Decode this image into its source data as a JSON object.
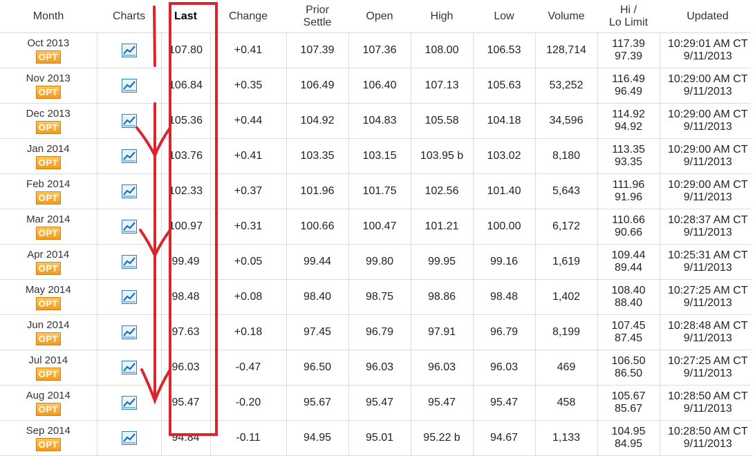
{
  "headers": {
    "month": "Month",
    "charts": "Charts",
    "last": "Last",
    "change": "Change",
    "prior_settle_line1": "Prior",
    "prior_settle_line2": "Settle",
    "open": "Open",
    "high": "High",
    "low": "Low",
    "volume": "Volume",
    "hilo_line1": "Hi /",
    "hilo_line2": "Lo Limit",
    "updated": "Updated"
  },
  "opt_label": "OPT",
  "colors": {
    "positive": "#1f8f1f",
    "negative": "#d62020",
    "annotation": "#d9252b",
    "opt_badge": "#f29a1e"
  },
  "icons": {
    "chart": "line-chart-icon"
  },
  "rows": [
    {
      "month": "Oct 2013",
      "last": "107.80",
      "change": "+0.41",
      "prior": "107.39",
      "open": "107.36",
      "high": "108.00",
      "low": "106.53",
      "volume": "128,714",
      "hi": "117.39",
      "lo": "97.39",
      "time": "10:29:01 AM CT",
      "date": "9/11/2013"
    },
    {
      "month": "Nov 2013",
      "last": "106.84",
      "change": "+0.35",
      "prior": "106.49",
      "open": "106.40",
      "high": "107.13",
      "low": "105.63",
      "volume": "53,252",
      "hi": "116.49",
      "lo": "96.49",
      "time": "10:29:00 AM CT",
      "date": "9/11/2013"
    },
    {
      "month": "Dec 2013",
      "last": "105.36",
      "change": "+0.44",
      "prior": "104.92",
      "open": "104.83",
      "high": "105.58",
      "low": "104.18",
      "volume": "34,596",
      "hi": "114.92",
      "lo": "94.92",
      "time": "10:29:00 AM CT",
      "date": "9/11/2013"
    },
    {
      "month": "Jan 2014",
      "last": "103.76",
      "change": "+0.41",
      "prior": "103.35",
      "open": "103.15",
      "high": "103.95 b",
      "low": "103.02",
      "volume": "8,180",
      "hi": "113.35",
      "lo": "93.35",
      "time": "10:29:00 AM CT",
      "date": "9/11/2013"
    },
    {
      "month": "Feb 2014",
      "last": "102.33",
      "change": "+0.37",
      "prior": "101.96",
      "open": "101.75",
      "high": "102.56",
      "low": "101.40",
      "volume": "5,643",
      "hi": "111.96",
      "lo": "91.96",
      "time": "10:29:00 AM CT",
      "date": "9/11/2013"
    },
    {
      "month": "Mar 2014",
      "last": "100.97",
      "change": "+0.31",
      "prior": "100.66",
      "open": "100.47",
      "high": "101.21",
      "low": "100.00",
      "volume": "6,172",
      "hi": "110.66",
      "lo": "90.66",
      "time": "10:28:37 AM CT",
      "date": "9/11/2013"
    },
    {
      "month": "Apr 2014",
      "last": "99.49",
      "change": "+0.05",
      "prior": "99.44",
      "open": "99.80",
      "high": "99.95",
      "low": "99.16",
      "volume": "1,619",
      "hi": "109.44",
      "lo": "89.44",
      "time": "10:25:31 AM CT",
      "date": "9/11/2013"
    },
    {
      "month": "May 2014",
      "last": "98.48",
      "change": "+0.08",
      "prior": "98.40",
      "open": "98.75",
      "high": "98.86",
      "low": "98.48",
      "volume": "1,402",
      "hi": "108.40",
      "lo": "88.40",
      "time": "10:27:25 AM CT",
      "date": "9/11/2013"
    },
    {
      "month": "Jun 2014",
      "last": "97.63",
      "change": "+0.18",
      "prior": "97.45",
      "open": "96.79",
      "high": "97.91",
      "low": "96.79",
      "volume": "8,199",
      "hi": "107.45",
      "lo": "87.45",
      "time": "10:28:48 AM CT",
      "date": "9/11/2013"
    },
    {
      "month": "Jul 2014",
      "last": "96.03",
      "change": "-0.47",
      "prior": "96.50",
      "open": "96.03",
      "high": "96.03",
      "low": "96.03",
      "volume": "469",
      "hi": "106.50",
      "lo": "86.50",
      "time": "10:27:25 AM CT",
      "date": "9/11/2013"
    },
    {
      "month": "Aug 2014",
      "last": "95.47",
      "change": "-0.20",
      "prior": "95.67",
      "open": "95.47",
      "high": "95.47",
      "low": "95.47",
      "volume": "458",
      "hi": "105.67",
      "lo": "85.67",
      "time": "10:28:50 AM CT",
      "date": "9/11/2013"
    },
    {
      "month": "Sep 2014",
      "last": "94.84",
      "change": "-0.11",
      "prior": "94.95",
      "open": "95.01",
      "high": "95.22 b",
      "low": "94.67",
      "volume": "1,133",
      "hi": "104.95",
      "lo": "84.95",
      "time": "10:28:50 AM CT",
      "date": "9/11/2013"
    }
  ]
}
